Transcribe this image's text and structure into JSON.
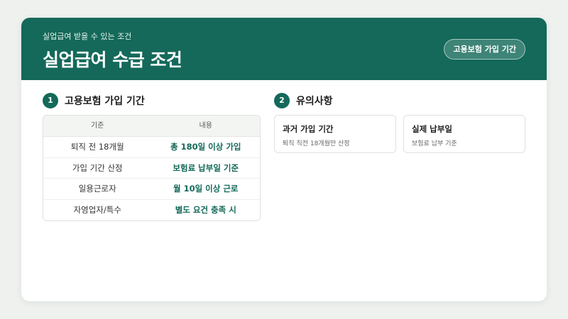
{
  "header": {
    "subtitle": "실업급여 받을 수 있는 조건",
    "title": "실업급여 수급 조건",
    "badge": "고용보험 가입 기간"
  },
  "section1": {
    "number": "1",
    "title": "고용보험 가입 기간",
    "table": {
      "headers": [
        "기준",
        "내용"
      ],
      "rows": [
        {
          "criterion": "퇴직 전 18개월",
          "content": "총 180일 이상 가입"
        },
        {
          "criterion": "가입 기간 산정",
          "content": "보험료 납부일 기준"
        },
        {
          "criterion": "일용근로자",
          "content": "월 10일 이상 근로"
        },
        {
          "criterion": "자영업자/특수",
          "content": "별도 요건 충족 시"
        }
      ]
    }
  },
  "section2": {
    "number": "2",
    "title": "유의사항",
    "cards": [
      {
        "title": "과거 가입 기간",
        "desc": "퇴직 직전 18개월만 산정"
      },
      {
        "title": "실제 납부일",
        "desc": "보험료 납부 기준"
      }
    ]
  },
  "colors": {
    "brand": "#14695a",
    "background": "#eef1ee",
    "card": "#ffffff"
  }
}
